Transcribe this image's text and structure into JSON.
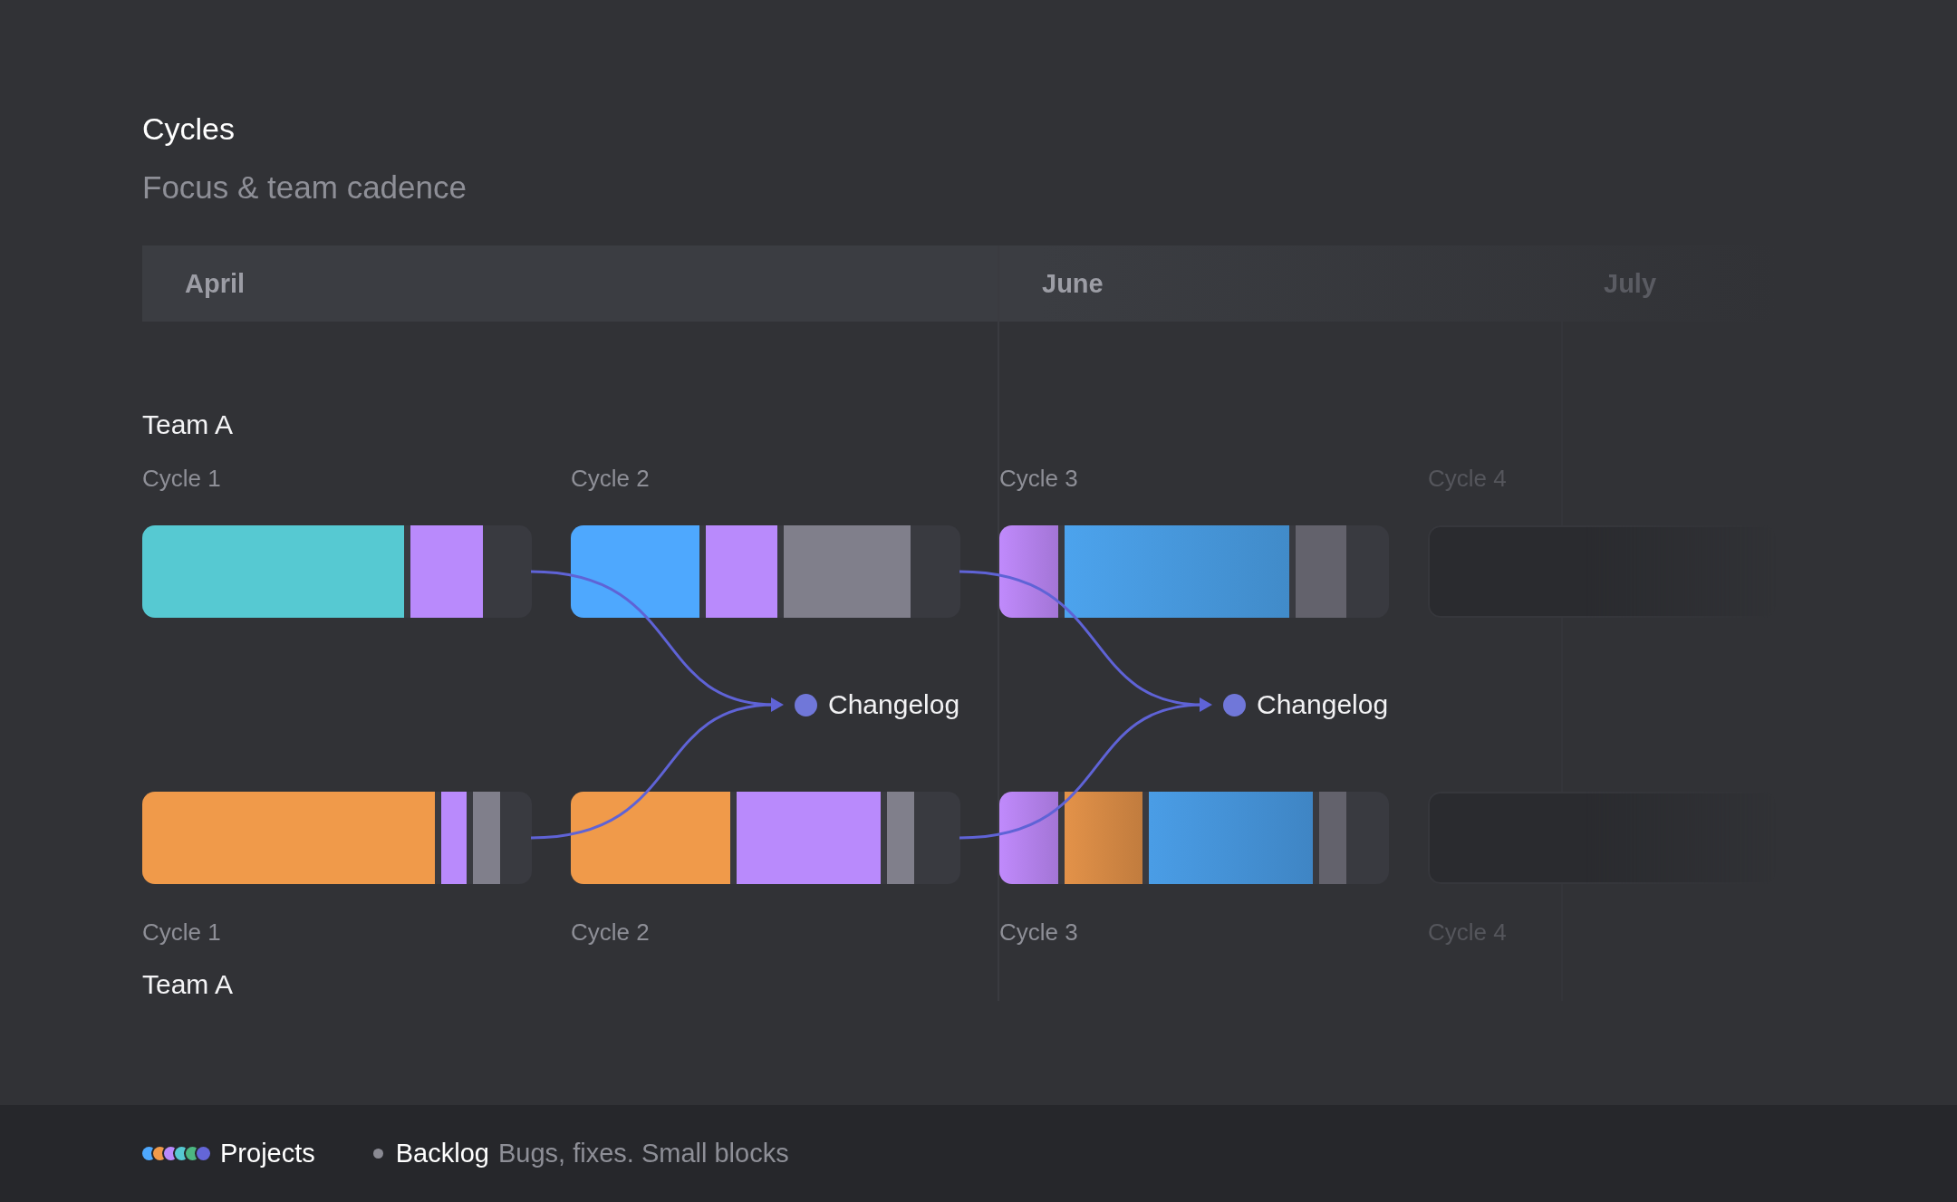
{
  "title": "Cycles",
  "subtitle": "Focus & team cadence",
  "months": [
    {
      "label": "April",
      "faded": false
    },
    {
      "label": "June",
      "faded": false
    },
    {
      "label": "July",
      "faded": true
    }
  ],
  "top_lane": {
    "team": "Team A",
    "cycles": [
      {
        "label": "Cycle 1",
        "kind": "active",
        "segments": [
          {
            "kind": "solid",
            "color": "#56c9d2"
          },
          {
            "kind": "solid",
            "color": "#b98afc"
          }
        ]
      },
      {
        "label": "Cycle 2",
        "kind": "active",
        "segments": [
          {
            "kind": "solid",
            "color": "#4ea8fe"
          },
          {
            "kind": "solid",
            "color": "#b98afc"
          },
          {
            "kind": "solid",
            "color": "#807f8b"
          }
        ]
      },
      {
        "label": "Cycle 3",
        "kind": "active",
        "segments": [
          {
            "kind": "gradient",
            "color": "#c08afc"
          },
          {
            "kind": "gradient",
            "color": "#4ca3ed"
          },
          {
            "kind": "solid",
            "color": "#63626c"
          }
        ]
      },
      {
        "label": "Cycle 4",
        "kind": "planned"
      }
    ]
  },
  "changelogs": [
    {
      "label": "Changelog"
    },
    {
      "label": "Changelog"
    }
  ],
  "bottom_lane": {
    "team": "Team A",
    "cycles": [
      {
        "label": "Cycle 1",
        "kind": "active",
        "segments": [
          {
            "kind": "solid",
            "color": "#f09a4a"
          },
          {
            "kind": "solid",
            "color": "#b98afc"
          },
          {
            "kind": "solid",
            "color": "#807f8b"
          }
        ]
      },
      {
        "label": "Cycle 2",
        "kind": "active",
        "segments": [
          {
            "kind": "solid",
            "color": "#f09a4a"
          },
          {
            "kind": "solid",
            "color": "#b98afc"
          },
          {
            "kind": "solid",
            "color": "#807f8b"
          }
        ]
      },
      {
        "label": "Cycle 3",
        "kind": "active",
        "segments": [
          {
            "kind": "gradient",
            "color": "#c08afc"
          },
          {
            "kind": "gradient",
            "color": "#e39249"
          },
          {
            "kind": "gradient",
            "color": "#4a9de6"
          },
          {
            "kind": "solid",
            "color": "#63626c"
          }
        ]
      },
      {
        "label": "Cycle 4",
        "kind": "planned"
      }
    ]
  },
  "footer": {
    "legend": [
      {
        "kind": "projects",
        "label": "Projects",
        "dots": [
          {
            "color": "#4ea8fe"
          },
          {
            "color": "#f09a4a"
          },
          {
            "color": "#b98afc"
          },
          {
            "color": "#56c9d2"
          },
          {
            "color": "#4cb782"
          },
          {
            "color": "#6466d8"
          }
        ]
      },
      {
        "kind": "backlog",
        "label": "Backlog",
        "description": "Bugs, fixes. Small blocks",
        "color": "#8a8a93"
      }
    ]
  }
}
